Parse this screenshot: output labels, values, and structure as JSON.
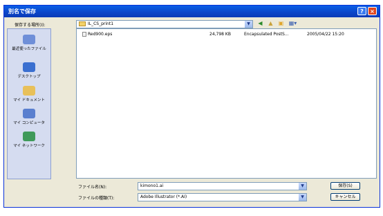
{
  "window": {
    "title": "別名で保存",
    "help_label": "?",
    "close_label": "×"
  },
  "location": {
    "label": "保存する場所(I):",
    "value": "IL_CS_print1"
  },
  "places": [
    {
      "label": "最近使ったファイル",
      "icon": "recent-icon",
      "color": "#6f8fd8"
    },
    {
      "label": "デスクトップ",
      "icon": "desktop-icon",
      "color": "#3a6fd0"
    },
    {
      "label": "マイ ドキュメント",
      "icon": "my-documents-icon",
      "color": "#e8c05a"
    },
    {
      "label": "マイ コンピュータ",
      "icon": "my-computer-icon",
      "color": "#5a7fcf"
    },
    {
      "label": "マイ ネットワーク",
      "icon": "my-network-icon",
      "color": "#3f9a5a"
    }
  ],
  "files": [
    {
      "name": "Red900.eps",
      "size": "24,798 KB",
      "type": "Encapsulated PostS...",
      "modified": "2005/04/22 15:20"
    }
  ],
  "filename": {
    "label": "ファイル名(N):",
    "value": "kimono1.ai"
  },
  "filetype": {
    "label": "ファイルの種類(T):",
    "value": "Adobe Illustrator (*.AI)"
  },
  "buttons": {
    "save": "保存(S)",
    "cancel": "キャンセル"
  },
  "colors": {
    "titlebar": "#0b45c8",
    "dialog_bg": "#ece9d8",
    "close": "#e0461e"
  }
}
